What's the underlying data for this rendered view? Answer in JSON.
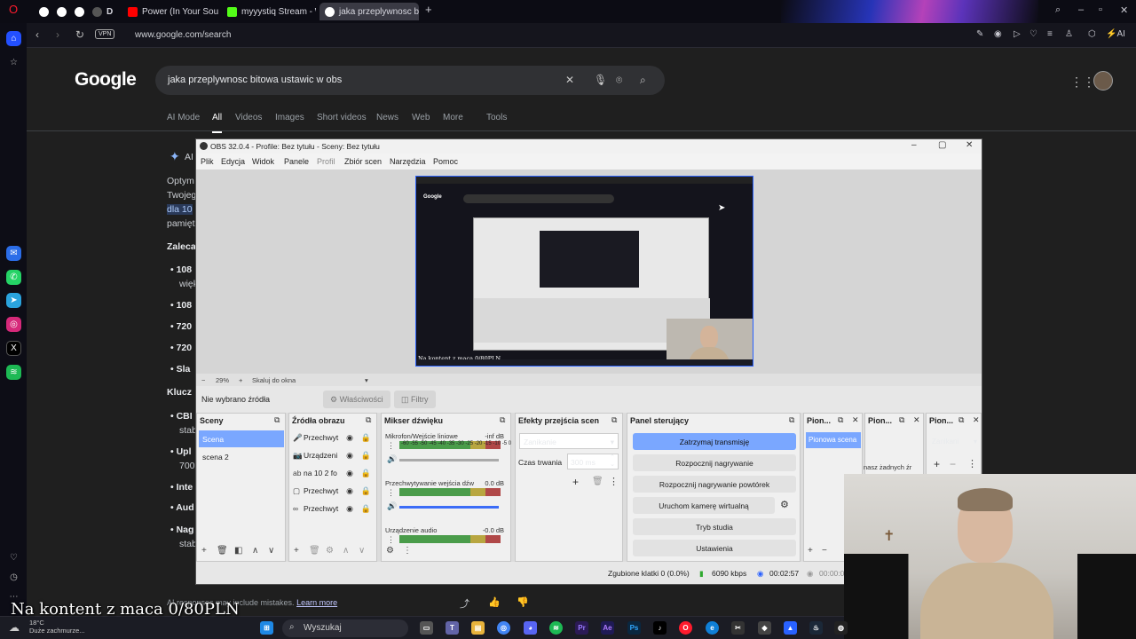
{
  "browser": {
    "tabs": [
      {
        "label": "Power (In Your Soul) - You",
        "color": "#ff0000"
      },
      {
        "label": "myyystiq Stream - Watch",
        "color": "#53fc18"
      },
      {
        "label": "jaka przeplywnosc bitowa",
        "color": "#4285f4"
      }
    ],
    "pinned": [
      "G",
      "G",
      "G",
      "D"
    ],
    "url": "www.google.com/search",
    "vpn": "VPN",
    "ai_label": "AI"
  },
  "google": {
    "logo": "Google",
    "query": "jaka przeplywnosc bitowa ustawic w obs",
    "tabs": [
      "AI Mode",
      "All",
      "Videos",
      "Images",
      "Short videos",
      "News",
      "Web",
      "More",
      "Tools"
    ],
    "ai_badge": "AI",
    "para": [
      "Optym",
      "Twojeg",
      "dla 10",
      "pamięt"
    ],
    "heading1": "Zaleca",
    "bullets1": [
      "108",
      "więk",
      "108",
      "720",
      "720",
      "Sla"
    ],
    "heading2": "Klucz",
    "bullets2": [
      "CBI",
      "stab",
      "Upl",
      "700",
      "Inte",
      "Aud",
      "Nag",
      "stab"
    ],
    "footer_text": "AI responses may include mistakes.",
    "footer_link": "Learn more"
  },
  "obs": {
    "title": "OBS 32.0.4 - Profile: Bez tytułu - Sceny: Bez tytułu",
    "menu": [
      "Plik",
      "Edycja",
      "Widok",
      "Panele",
      "Profil",
      "Zbiór scen",
      "Narzędzia",
      "Pomoc"
    ],
    "zoom": "29%",
    "zoom_mode": "Skaluj do okna",
    "canvas_caption": "Na kontent z maca 0/80PLN",
    "no_source": "Nie wybrano źródła",
    "properties_btn": "Właściwości",
    "filters_btn": "Filtry",
    "scenes_title": "Sceny",
    "scenes": [
      "Scena",
      "scena 2"
    ],
    "sources_title": "Źródła obrazu",
    "sources": [
      {
        "icon": "mic-icon",
        "glyph": "🎤",
        "name": "Przechwyt"
      },
      {
        "icon": "camera-icon",
        "glyph": "📷",
        "name": "Urządzeni"
      },
      {
        "icon": "text-icon",
        "glyph": "ab",
        "name": "na 10 2 fo"
      },
      {
        "icon": "display-icon",
        "glyph": "▢",
        "name": "Przechwyt"
      },
      {
        "icon": "link-icon",
        "glyph": "∞",
        "name": "Przechwyt"
      }
    ],
    "mixer_title": "Mikser dźwięku",
    "mixer": [
      {
        "name": "Mikrofon/Wejście liniowe",
        "db": "-inf dB",
        "level": 0.0
      },
      {
        "name": "Przechwytywanie wejścia dźw",
        "db": "0.0 dB",
        "level": 1.0
      },
      {
        "name": "Urządzenie audio",
        "db": "-0.0 dB",
        "level": 1.0
      }
    ],
    "meter_scale": "-60 -55 -50 -45 -40 -35 -30 -25 -20 -15 -10 -5 0",
    "transitions_title": "Efekty przejścia scen",
    "transition": "Zanikanie",
    "duration_label": "Czas trwania",
    "duration": "300 ms",
    "controls_title": "Panel sterujący",
    "controls": [
      "Zatrzymaj transmisję",
      "Rozpocznij nagrywanie",
      "Rozpocznij nagrywanie powtórek",
      "Uruchom kamerę wirtualną",
      "Tryb studia",
      "Ustawienia"
    ],
    "vert1_title": "Pion...",
    "vert1_scene": "Pionowa scena",
    "vert2_title": "Pion...",
    "vert2_text": "nasz żadnych źr",
    "vert3_title": "Pion...",
    "vert3_transition": "Zanikani",
    "status": {
      "dropped": "Zgubione klatki 0 (0.0%)",
      "bitrate": "6090 kbps",
      "stream_time": "00:02:57",
      "rec_time": "00:00:0"
    }
  },
  "overlay_caption": "Na kontent z maca 0/80PLN",
  "taskbar": {
    "search": "Wyszukaj",
    "weather_temp": "18°C",
    "weather_desc": "Duże zachmurze..."
  }
}
